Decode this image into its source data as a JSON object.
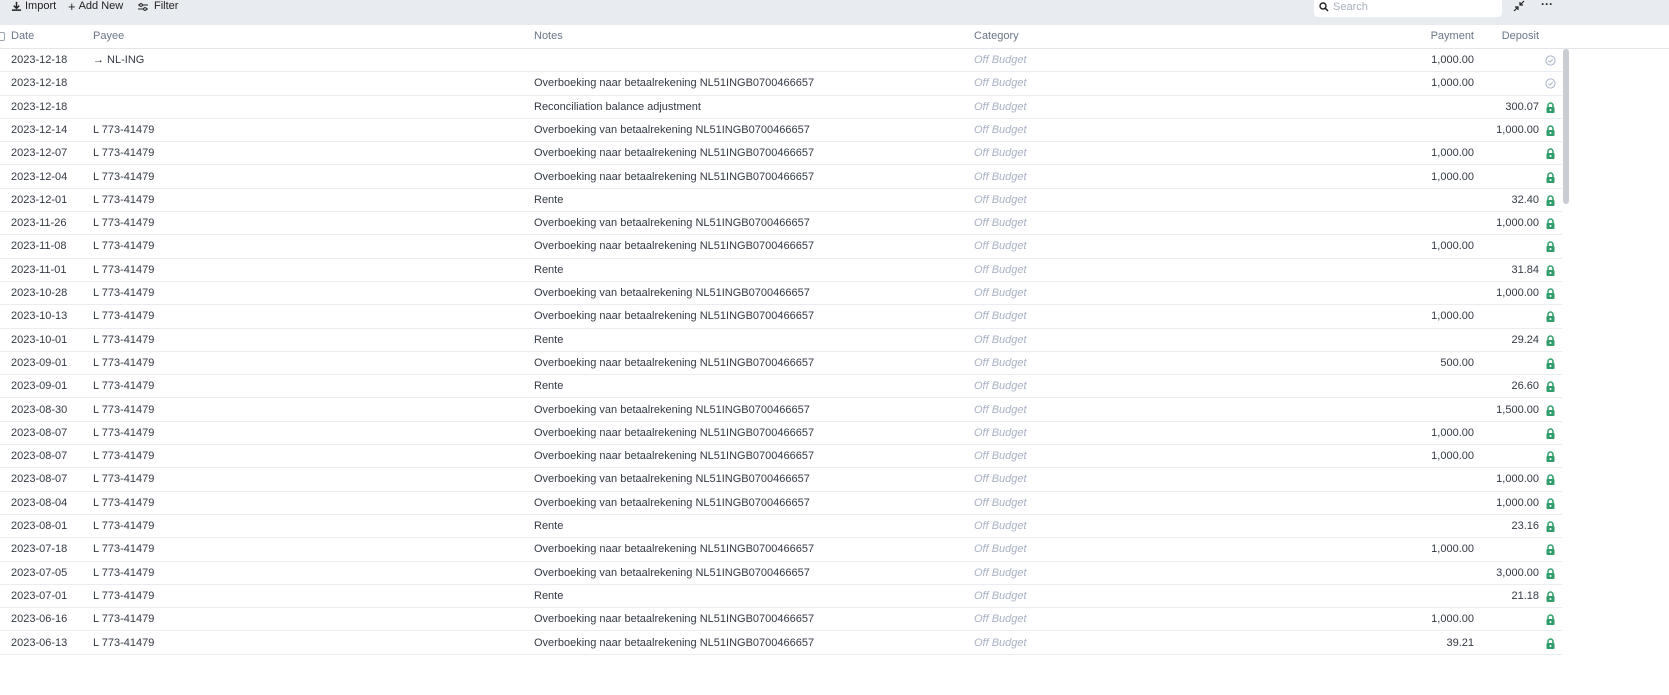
{
  "toolbar": {
    "import": "Import",
    "add_new": "Add New",
    "filter": "Filter",
    "search_placeholder": "Search"
  },
  "columns": {
    "date": "Date",
    "payee": "Payee",
    "notes": "Notes",
    "category": "Category",
    "payment": "Payment",
    "deposit": "Deposit"
  },
  "colors": {
    "lock": "#2f9e6b",
    "check": "#a9b4c6"
  },
  "rows": [
    {
      "date": "2023-12-18",
      "payee": "→  NL-ING",
      "notes": "",
      "category": "Off Budget",
      "payment": "1,000.00",
      "deposit": "",
      "status": "cleared"
    },
    {
      "date": "2023-12-18",
      "payee": "",
      "notes": "Overboeking naar betaalrekening NL51INGB0700466657",
      "category": "Off Budget",
      "payment": "1,000.00",
      "deposit": "",
      "status": "cleared"
    },
    {
      "date": "2023-12-18",
      "payee": "",
      "notes": "Reconciliation balance adjustment",
      "category": "Off Budget",
      "payment": "",
      "deposit": "300.07",
      "status": "locked"
    },
    {
      "date": "2023-12-14",
      "payee": "L 773-41479",
      "notes": "Overboeking van betaalrekening NL51INGB0700466657",
      "category": "Off Budget",
      "payment": "",
      "deposit": "1,000.00",
      "status": "locked"
    },
    {
      "date": "2023-12-07",
      "payee": "L 773-41479",
      "notes": "Overboeking naar betaalrekening NL51INGB0700466657",
      "category": "Off Budget",
      "payment": "1,000.00",
      "deposit": "",
      "status": "locked"
    },
    {
      "date": "2023-12-04",
      "payee": "L 773-41479",
      "notes": "Overboeking naar betaalrekening NL51INGB0700466657",
      "category": "Off Budget",
      "payment": "1,000.00",
      "deposit": "",
      "status": "locked"
    },
    {
      "date": "2023-12-01",
      "payee": "L 773-41479",
      "notes": "Rente",
      "category": "Off Budget",
      "payment": "",
      "deposit": "32.40",
      "status": "locked"
    },
    {
      "date": "2023-11-26",
      "payee": "L 773-41479",
      "notes": "Overboeking van betaalrekening NL51INGB0700466657",
      "category": "Off Budget",
      "payment": "",
      "deposit": "1,000.00",
      "status": "locked"
    },
    {
      "date": "2023-11-08",
      "payee": "L 773-41479",
      "notes": "Overboeking naar betaalrekening NL51INGB0700466657",
      "category": "Off Budget",
      "payment": "1,000.00",
      "deposit": "",
      "status": "locked"
    },
    {
      "date": "2023-11-01",
      "payee": "L 773-41479",
      "notes": "Rente",
      "category": "Off Budget",
      "payment": "",
      "deposit": "31.84",
      "status": "locked"
    },
    {
      "date": "2023-10-28",
      "payee": "L 773-41479",
      "notes": "Overboeking van betaalrekening NL51INGB0700466657",
      "category": "Off Budget",
      "payment": "",
      "deposit": "1,000.00",
      "status": "locked"
    },
    {
      "date": "2023-10-13",
      "payee": "L 773-41479",
      "notes": "Overboeking naar betaalrekening NL51INGB0700466657",
      "category": "Off Budget",
      "payment": "1,000.00",
      "deposit": "",
      "status": "locked"
    },
    {
      "date": "2023-10-01",
      "payee": "L 773-41479",
      "notes": "Rente",
      "category": "Off Budget",
      "payment": "",
      "deposit": "29.24",
      "status": "locked"
    },
    {
      "date": "2023-09-01",
      "payee": "L 773-41479",
      "notes": "Overboeking naar betaalrekening NL51INGB0700466657",
      "category": "Off Budget",
      "payment": "500.00",
      "deposit": "",
      "status": "locked"
    },
    {
      "date": "2023-09-01",
      "payee": "L 773-41479",
      "notes": "Rente",
      "category": "Off Budget",
      "payment": "",
      "deposit": "26.60",
      "status": "locked"
    },
    {
      "date": "2023-08-30",
      "payee": "L 773-41479",
      "notes": "Overboeking van betaalrekening NL51INGB0700466657",
      "category": "Off Budget",
      "payment": "",
      "deposit": "1,500.00",
      "status": "locked"
    },
    {
      "date": "2023-08-07",
      "payee": "L 773-41479",
      "notes": "Overboeking naar betaalrekening NL51INGB0700466657",
      "category": "Off Budget",
      "payment": "1,000.00",
      "deposit": "",
      "status": "locked"
    },
    {
      "date": "2023-08-07",
      "payee": "L 773-41479",
      "notes": "Overboeking naar betaalrekening NL51INGB0700466657",
      "category": "Off Budget",
      "payment": "1,000.00",
      "deposit": "",
      "status": "locked"
    },
    {
      "date": "2023-08-07",
      "payee": "L 773-41479",
      "notes": "Overboeking van betaalrekening NL51INGB0700466657",
      "category": "Off Budget",
      "payment": "",
      "deposit": "1,000.00",
      "status": "locked"
    },
    {
      "date": "2023-08-04",
      "payee": "L 773-41479",
      "notes": "Overboeking van betaalrekening NL51INGB0700466657",
      "category": "Off Budget",
      "payment": "",
      "deposit": "1,000.00",
      "status": "locked"
    },
    {
      "date": "2023-08-01",
      "payee": "L 773-41479",
      "notes": "Rente",
      "category": "Off Budget",
      "payment": "",
      "deposit": "23.16",
      "status": "locked"
    },
    {
      "date": "2023-07-18",
      "payee": "L 773-41479",
      "notes": "Overboeking naar betaalrekening NL51INGB0700466657",
      "category": "Off Budget",
      "payment": "1,000.00",
      "deposit": "",
      "status": "locked"
    },
    {
      "date": "2023-07-05",
      "payee": "L 773-41479",
      "notes": "Overboeking van betaalrekening NL51INGB0700466657",
      "category": "Off Budget",
      "payment": "",
      "deposit": "3,000.00",
      "status": "locked"
    },
    {
      "date": "2023-07-01",
      "payee": "L 773-41479",
      "notes": "Rente",
      "category": "Off Budget",
      "payment": "",
      "deposit": "21.18",
      "status": "locked"
    },
    {
      "date": "2023-06-16",
      "payee": "L 773-41479",
      "notes": "Overboeking naar betaalrekening NL51INGB0700466657",
      "category": "Off Budget",
      "payment": "1,000.00",
      "deposit": "",
      "status": "locked"
    },
    {
      "date": "2023-06-13",
      "payee": "L 773-41479",
      "notes": "Overboeking naar betaalrekening NL51INGB0700466657",
      "category": "Off Budget",
      "payment": "39.21",
      "deposit": "",
      "status": "locked"
    }
  ]
}
